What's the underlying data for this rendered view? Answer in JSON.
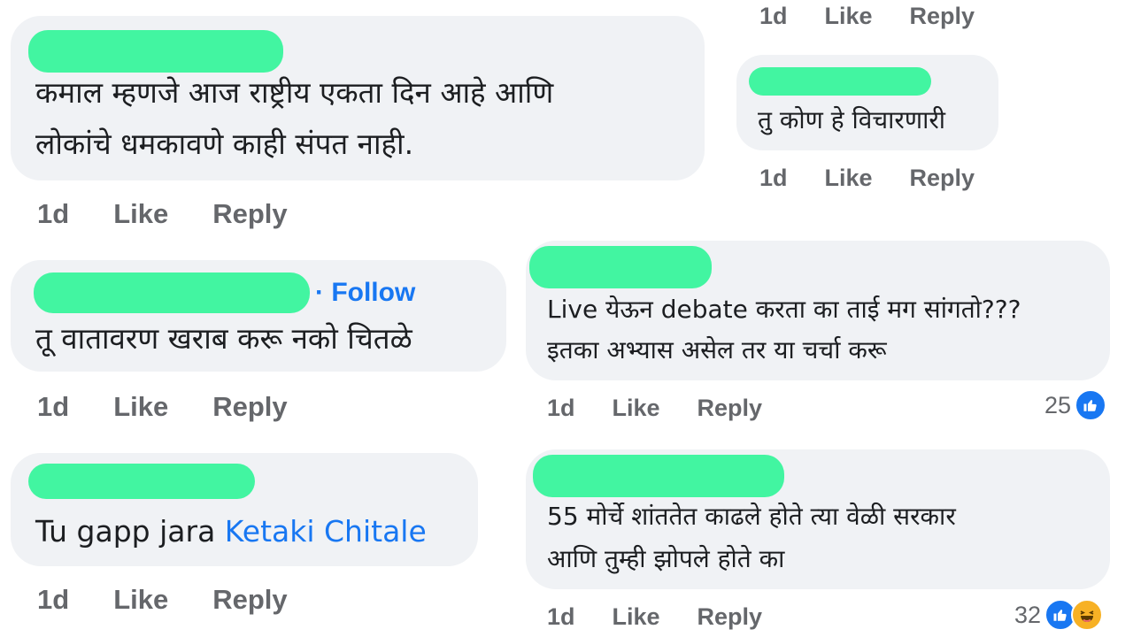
{
  "comments": [
    {
      "id": "c1",
      "lines": [
        "कमाल म्हणजे आज राष्ट्रीय एकता दिन आहे आणि",
        "लोकांचे धमकावणे काही संपत नाही."
      ],
      "time": "1d",
      "like": "Like",
      "reply": "Reply"
    },
    {
      "id": "c2",
      "follow": "· Follow",
      "lines": [
        "तू वातावरण खराब करू नको चितळे"
      ],
      "time": "1d",
      "like": "Like",
      "reply": "Reply"
    },
    {
      "id": "c3",
      "text_before": "Tu gapp jara ",
      "mention": "Ketaki Chitale",
      "time": "1d",
      "like": "Like",
      "reply": "Reply"
    },
    {
      "id": "r0",
      "time": "1d",
      "like": "Like",
      "reply": "Reply"
    },
    {
      "id": "r1",
      "lines": [
        "तु कोण हे विचारणारी"
      ],
      "time": "1d",
      "like": "Like",
      "reply": "Reply"
    },
    {
      "id": "r2",
      "lines": [
        "Live येऊन debate करता का ताई मग सांगतो???",
        "इतका अभ्यास असेल तर या चर्चा करू"
      ],
      "time": "1d",
      "like": "Like",
      "reply": "Reply",
      "reaction_count": "25",
      "reaction_icons": [
        "like-icon"
      ]
    },
    {
      "id": "r3",
      "lines": [
        "55 मोर्चे शांततेत काढले होते त्या वेळी सरकार",
        "आणि तुम्ही झोपले होते का"
      ],
      "time": "1d",
      "like": "Like",
      "reply": "Reply",
      "reaction_count": "32",
      "reaction_icons": [
        "like-icon",
        "haha-icon"
      ]
    }
  ],
  "colors": {
    "bubble": "#f0f2f5",
    "redaction": "#42f5a1",
    "link": "#1877f2",
    "meta": "#65676b",
    "haha": "#f7b125"
  }
}
